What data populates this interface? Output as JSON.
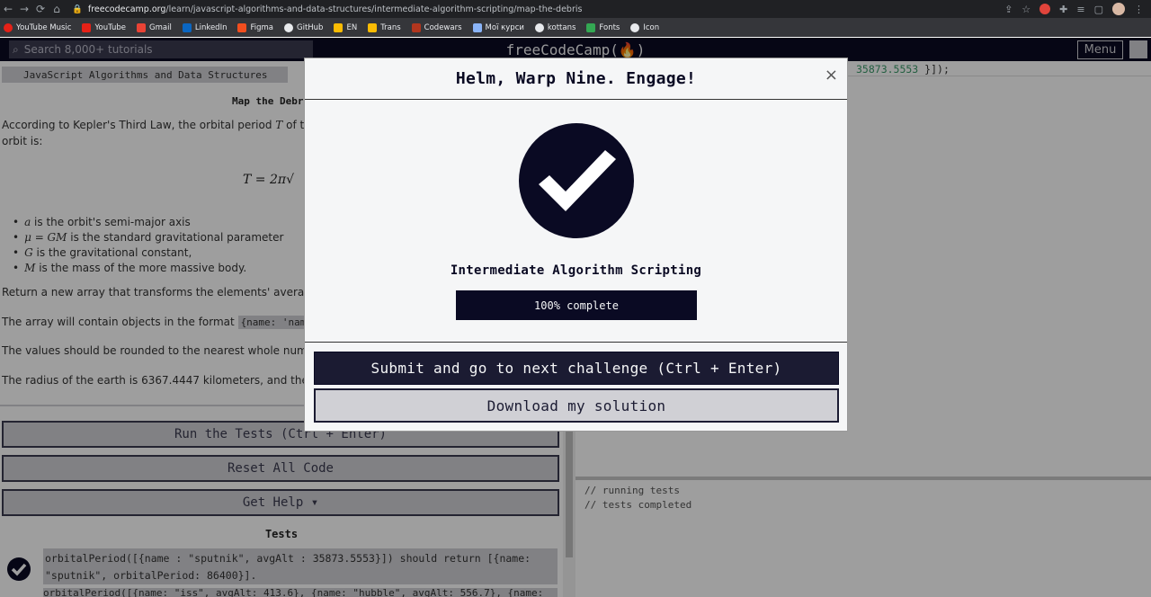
{
  "browser": {
    "url_host": "freecodecamp.org",
    "url_path": "/learn/javascript-algorithms-and-data-structures/intermediate-algorithm-scripting/map-the-debris",
    "bookmarks": [
      "YouTube Music",
      "YouTube",
      "Gmail",
      "LinkedIn",
      "Figma",
      "GitHub",
      "EN",
      "Trans",
      "Codewars",
      "Мої курси",
      "kottans",
      "Fonts",
      "Icon"
    ]
  },
  "nav": {
    "search_placeholder": "Search 8,000+ tutorials",
    "logo": "freeCodeCamp(🔥)",
    "menu_label": "Menu"
  },
  "left": {
    "breadcrumb": "JavaScript Algorithms and Data Structures",
    "challenge_title": "Map the Debr",
    "p1a": "According to Kepler's Third Law, the orbital period ",
    "p1_var": "T",
    "p1b": " of two poi",
    "p1c": "orbit is:",
    "formula": "T = 2π√",
    "bullets": [
      {
        "var": "a",
        "text": " is the orbit's semi-major axis"
      },
      {
        "var": "μ = GM",
        "text": " is the standard gravitational parameter"
      },
      {
        "var": "G",
        "text": " is the gravitational constant,"
      },
      {
        "var": "M",
        "text": " is the mass of the more massive body."
      }
    ],
    "p2": "Return a new array that transforms the elements' average altitu",
    "p3a": "The array will contain objects in the format ",
    "p3_code": "{name: 'name', a",
    "p4": "The values should be rounded to the nearest whole number. The",
    "p5": "The radius of the earth is 6367.4447 kilometers, and the GM val",
    "run_tests": "Run the Tests (Ctrl + Enter)",
    "reset_code": "Reset All Code",
    "get_help": "Get Help ▾",
    "tests_title": "Tests",
    "test1_code": "orbitalPeriod([{name : \"sputnik\", avgAlt : 35873.5553}])",
    "test1_mid": " should return ",
    "test1_result": "[{name: \"sputnik\", orbitalPeriod: 86400}]",
    "test1_end": ".",
    "test2_code": "orbitalPeriod([{name: \"iss\", avgAlt: 413.6}, {name: \"hubble\", avgAlt: 556.7}, {name:"
  },
  "editor": {
    "line_value": "35873.5553",
    "line_end": " }]);"
  },
  "console": {
    "lines": [
      "// running tests",
      "// tests completed"
    ]
  },
  "modal": {
    "title": "Helm, Warp Nine. Engage!",
    "close": "×",
    "cert_name": "Intermediate Algorithm Scripting",
    "progress_label": "100% complete",
    "progress_value": 1.0,
    "submit_button": "Submit and go to next challenge (Ctrl + Enter)",
    "download_button": "Download my solution"
  },
  "colors": {
    "dark": "#0a0a23",
    "gray": "#d0d0d5",
    "light": "#f5f6f7"
  }
}
